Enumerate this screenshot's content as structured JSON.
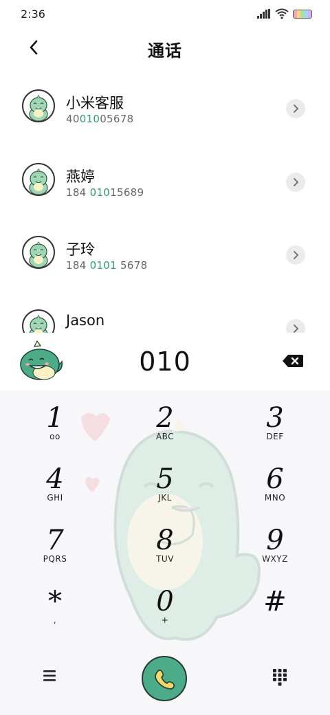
{
  "status_bar": {
    "time": "2:36"
  },
  "header": {
    "title": "通话"
  },
  "contacts": [
    {
      "name": "小米客服",
      "number_pre": "40",
      "number_hl": "010",
      "number_post": "05678"
    },
    {
      "name": "燕婷",
      "number_pre": "184 ",
      "number_hl": "010",
      "number_post": "15689"
    },
    {
      "name": "子玲",
      "number_pre": "184 ",
      "number_hl": "0101",
      "number_post": " 5678"
    },
    {
      "name": "Jason",
      "number_pre": "",
      "number_hl": "",
      "number_post": ""
    }
  ],
  "dialer": {
    "typed_number": "010"
  },
  "keypad": {
    "keys": [
      {
        "digit": "1",
        "letters": "ᴏᴏ"
      },
      {
        "digit": "2",
        "letters": "ABC"
      },
      {
        "digit": "3",
        "letters": "DEF"
      },
      {
        "digit": "4",
        "letters": "GHI"
      },
      {
        "digit": "5",
        "letters": "JKL"
      },
      {
        "digit": "6",
        "letters": "MNO"
      },
      {
        "digit": "7",
        "letters": "PQRS"
      },
      {
        "digit": "8",
        "letters": "TUV"
      },
      {
        "digit": "9",
        "letters": "WXYZ"
      },
      {
        "digit": "*",
        "letters": ","
      },
      {
        "digit": "0",
        "letters": "+"
      },
      {
        "digit": "#",
        "letters": ""
      }
    ]
  },
  "icons": {
    "back": "back-arrow-icon",
    "chevron": "chevron-right-icon",
    "backspace": "backspace-icon",
    "menu": "menu-icon",
    "call": "phone-icon",
    "keypad_toggle": "dialpad-icon",
    "voicemail": "voicemail-icon"
  },
  "colors": {
    "accent": "#4cab88",
    "highlight": "#2e9b77",
    "keypad_bg": "#f7f7fa"
  }
}
